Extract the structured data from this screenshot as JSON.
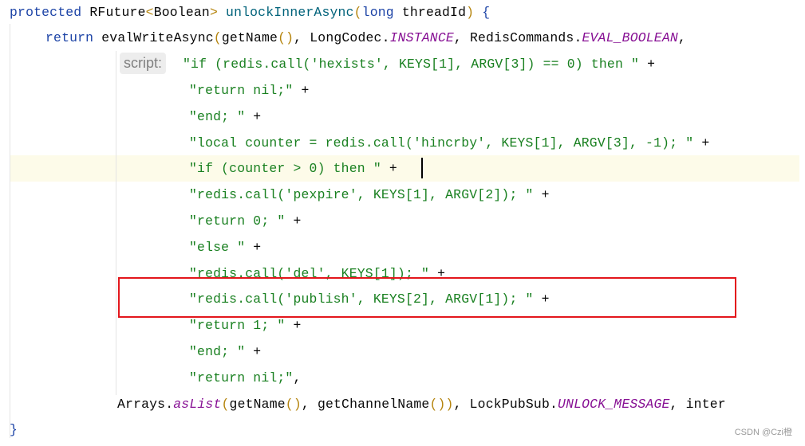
{
  "editor": {
    "inlay_hint": "script:",
    "highlighted_line": 6,
    "annotation_color": "#e3161c",
    "watermark": "CSDN @Czi橙",
    "lines": [
      [
        [
          "kw",
          "protected "
        ],
        [
          "plain",
          "RFuture"
        ],
        [
          "par",
          "<"
        ],
        [
          "plain",
          "Boolean"
        ],
        [
          "par",
          "> "
        ],
        [
          "fn",
          "unlockInnerAsync"
        ],
        [
          "par",
          "("
        ],
        [
          "kw",
          "long "
        ],
        [
          "plain",
          "threadId"
        ],
        [
          "par",
          ")"
        ],
        [
          "plain",
          " "
        ],
        [
          "brace",
          "{"
        ]
      ],
      [
        [
          "kw",
          "return "
        ],
        [
          "plain",
          "evalWriteAsync"
        ],
        [
          "par",
          "("
        ],
        [
          "plain",
          "getName"
        ],
        [
          "par",
          "()"
        ],
        [
          "plain",
          ", LongCodec."
        ],
        [
          "const",
          "INSTANCE"
        ],
        [
          "plain",
          ", RedisCommands."
        ],
        [
          "const",
          "EVAL_BOOLEAN"
        ],
        [
          "plain",
          ","
        ]
      ],
      [
        [
          "str",
          "\"if (redis.call('hexists', KEYS[1], ARGV[3]) == 0) then \""
        ],
        [
          "op",
          " +"
        ]
      ],
      [
        [
          "str",
          "\"return nil;\""
        ],
        [
          "op",
          " +"
        ]
      ],
      [
        [
          "str",
          "\"end; \""
        ],
        [
          "op",
          " +"
        ]
      ],
      [
        [
          "str",
          "\"local counter = redis.call('hincrby', KEYS[1], ARGV[3], -1); \""
        ],
        [
          "op",
          " +"
        ]
      ],
      [
        [
          "str",
          "\"if (counter > 0) then \""
        ],
        [
          "op",
          " +"
        ]
      ],
      [
        [
          "str",
          "\"redis.call('pexpire', KEYS[1], ARGV[2]); \""
        ],
        [
          "op",
          " +"
        ]
      ],
      [
        [
          "str",
          "\"return 0; \""
        ],
        [
          "op",
          " +"
        ]
      ],
      [
        [
          "str",
          "\"else \""
        ],
        [
          "op",
          " +"
        ]
      ],
      [
        [
          "str",
          "\"redis.call('del', KEYS[1]); \""
        ],
        [
          "op",
          " +"
        ]
      ],
      [
        [
          "str",
          "\"redis.call('publish', KEYS[2], ARGV[1]); \""
        ],
        [
          "op",
          " +"
        ]
      ],
      [
        [
          "str",
          "\"return 1; \""
        ],
        [
          "op",
          " +"
        ]
      ],
      [
        [
          "str",
          "\"end; \""
        ],
        [
          "op",
          " +"
        ]
      ],
      [
        [
          "str",
          "\"return nil;\""
        ],
        [
          "plain",
          ","
        ]
      ],
      [
        [
          "plain",
          "Arrays."
        ],
        [
          "const",
          "asList"
        ],
        [
          "par",
          "("
        ],
        [
          "plain",
          "getName"
        ],
        [
          "par",
          "()"
        ],
        [
          "plain",
          ", getChannelName"
        ],
        [
          "par",
          "())"
        ],
        [
          "plain",
          ", LockPubSub."
        ],
        [
          "const",
          "UNLOCK_MESSAGE"
        ],
        [
          "plain",
          ", inter"
        ]
      ],
      [
        [
          "brace",
          "}"
        ]
      ]
    ]
  }
}
